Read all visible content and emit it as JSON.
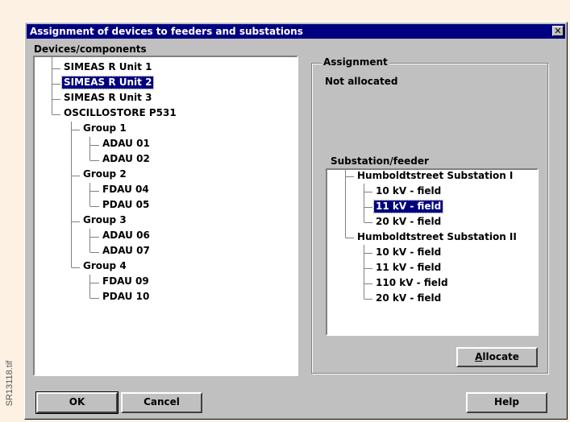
{
  "side_label": "SR13118.tif",
  "dialog": {
    "title": "Assignment of devices to feeders and substations",
    "close_symbol": "✕"
  },
  "devices": {
    "label": "Devices/components",
    "items": [
      {
        "label": "SIMEAS R  Unit 1",
        "selected": false
      },
      {
        "label": "SIMEAS R  Unit 2",
        "selected": true
      },
      {
        "label": "SIMEAS R  Unit 3",
        "selected": false
      },
      {
        "label": "OSCILLOSTORE P531",
        "selected": false
      },
      {
        "label": "Group 1",
        "selected": false
      },
      {
        "label": "ADAU 01",
        "selected": false
      },
      {
        "label": "ADAU 02",
        "selected": false
      },
      {
        "label": "Group 2",
        "selected": false
      },
      {
        "label": "FDAU 04",
        "selected": false
      },
      {
        "label": "PDAU 05",
        "selected": false
      },
      {
        "label": "Group 3",
        "selected": false
      },
      {
        "label": "ADAU 06",
        "selected": false
      },
      {
        "label": "ADAU 07",
        "selected": false
      },
      {
        "label": "Group 4",
        "selected": false
      },
      {
        "label": "FDAU 09",
        "selected": false
      },
      {
        "label": "PDAU 10",
        "selected": false
      }
    ]
  },
  "assignment": {
    "label": "Assignment",
    "status": "Not allocated"
  },
  "substation": {
    "label": "Substation/feeder",
    "items": [
      {
        "label": "Humboldtstreet  Substation I",
        "selected": false
      },
      {
        "label": "10 kV - field",
        "selected": false
      },
      {
        "label": "11 kV - field",
        "selected": true
      },
      {
        "label": "20 kV - field",
        "selected": false
      },
      {
        "label": "Humboldtstreet  Substation II",
        "selected": false
      },
      {
        "label": "10 kV - field",
        "selected": false
      },
      {
        "label": "11 kV - field",
        "selected": false
      },
      {
        "label": "110 kV - field",
        "selected": false
      },
      {
        "label": "20 kV - field",
        "selected": false
      }
    ]
  },
  "buttons": {
    "allocate_first": "A",
    "allocate_rest": "llocate",
    "ok": "OK",
    "cancel": "Cancel",
    "help": "Help"
  }
}
